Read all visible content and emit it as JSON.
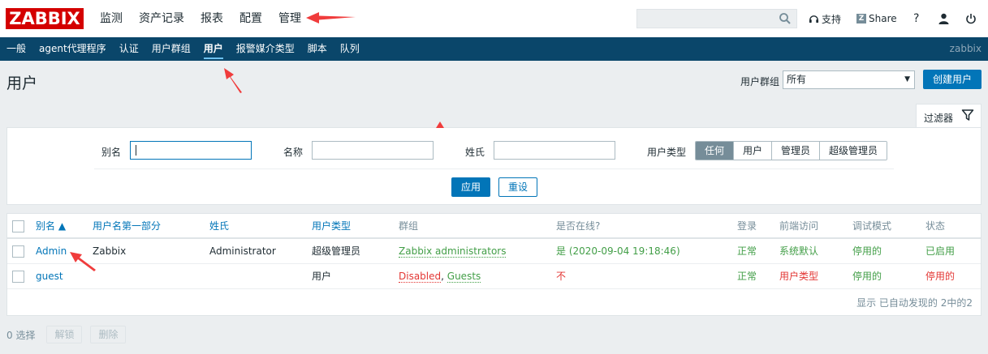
{
  "header": {
    "logo": "ZABBIX",
    "nav": [
      "监测",
      "资产记录",
      "报表",
      "配置",
      "管理"
    ],
    "active_nav": "管理",
    "support": "支持",
    "share": "Share",
    "share_badge": "Z",
    "help": "?"
  },
  "subnav": {
    "items": [
      "一般",
      "agent代理程序",
      "认证",
      "用户群组",
      "用户",
      "报警媒介类型",
      "脚本",
      "队列"
    ],
    "active": "用户",
    "host": "zabbix"
  },
  "page": {
    "title": "用户",
    "usergroup_label": "用户群组",
    "usergroup_value": "所有",
    "create_button": "创建用户"
  },
  "filter": {
    "tab_label": "过滤器",
    "alias_label": "别名",
    "alias_value": "",
    "name_label": "名称",
    "name_value": "",
    "surname_label": "姓氏",
    "surname_value": "",
    "type_label": "用户类型",
    "type_options": [
      "任何",
      "用户",
      "管理员",
      "超级管理员"
    ],
    "type_selected": "任何",
    "apply": "应用",
    "reset": "重设"
  },
  "table": {
    "columns": [
      "别名 ▲",
      "用户名第一部分",
      "姓氏",
      "用户类型",
      "群组",
      "是否在线?",
      "登录",
      "前端访问",
      "调试模式",
      "状态"
    ],
    "rows": [
      {
        "alias": "Admin",
        "name": "Zabbix",
        "surname": "Administrator",
        "type": "超级管理员",
        "groups": [
          {
            "label": "Zabbix administrators",
            "color": "green"
          }
        ],
        "online": "是 (2020-09-04 19:18:46)",
        "online_color": "green",
        "login": "正常",
        "frontend": "系统默认",
        "frontend_color": "green",
        "debug": "停用的",
        "status": "已启用",
        "status_color": "green"
      },
      {
        "alias": "guest",
        "name": "",
        "surname": "",
        "type": "用户",
        "groups": [
          {
            "label": "Disabled",
            "color": "red"
          },
          {
            "label": "Guests",
            "color": "green"
          }
        ],
        "online": "不",
        "online_color": "red",
        "login": "正常",
        "frontend": "用户类型",
        "frontend_color": "red",
        "debug": "停用的",
        "status": "停用的",
        "status_color": "red"
      }
    ],
    "footer": "显示 已自动发现的 2中的2"
  },
  "bottom": {
    "selected": "0 选择",
    "unblock": "解锁",
    "delete": "删除"
  },
  "colors": {
    "accent": "#0275b8",
    "nav_bg": "#0a466a",
    "logo_bg": "#d40000",
    "green": "#429e47",
    "red": "#e33734",
    "annotation": "#f03c3c"
  }
}
